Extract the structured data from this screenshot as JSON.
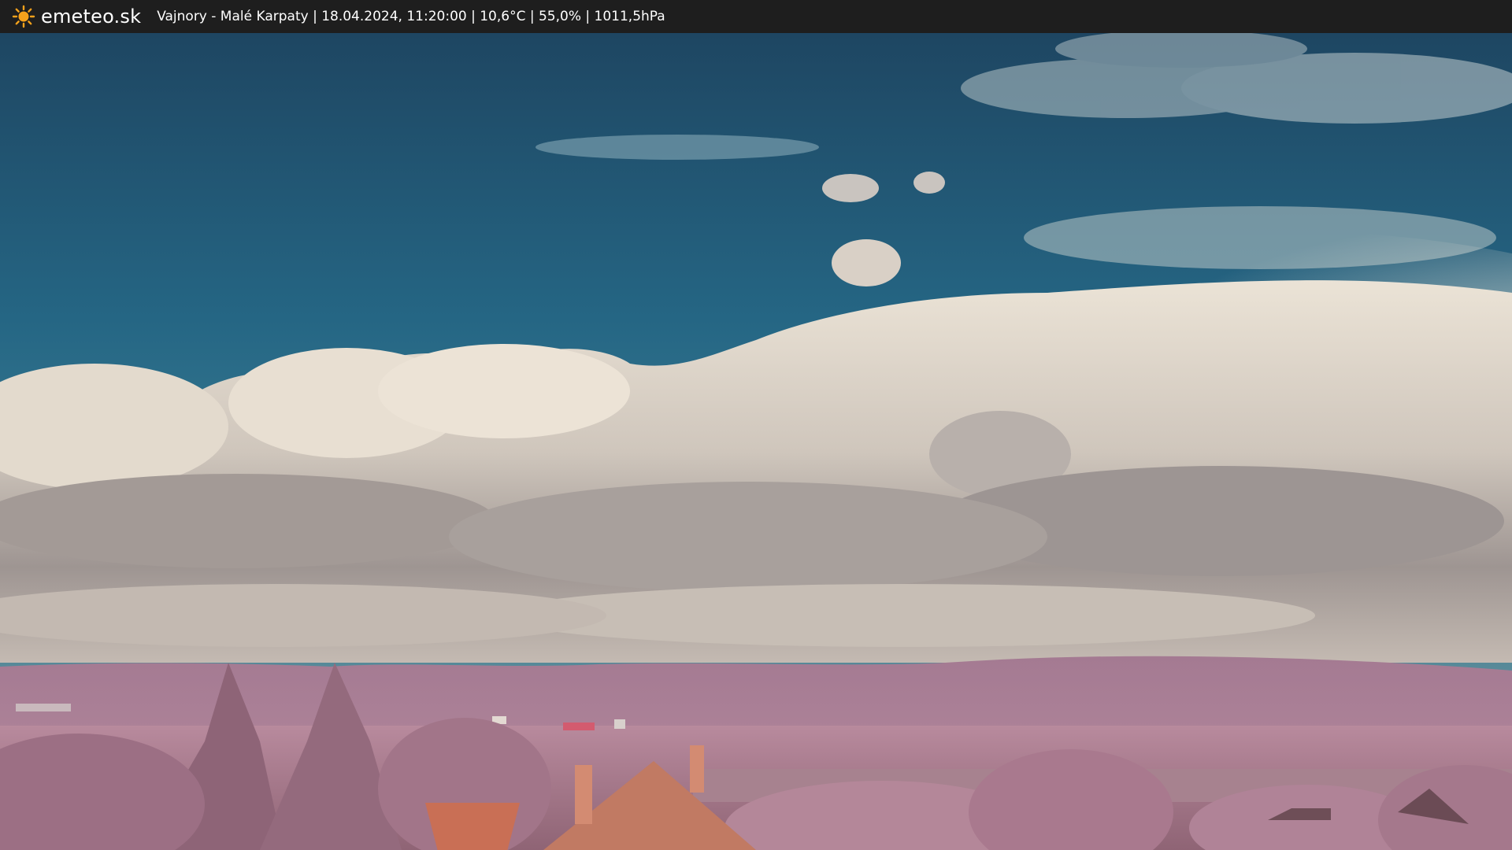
{
  "header": {
    "brand": "emeteo.sk",
    "logo_icon": "sun-icon",
    "caption": "Vajnory - Malé Karpaty | 18.04.2024, 11:20:00 | 10,6°C | 55,0% | 1011,5hPa"
  },
  "colors": {
    "bar": "#1e1e1e",
    "sun": "#f7a21b",
    "sky_top": "#1f4a68",
    "sky_mid": "#2a6f8c",
    "cloud_light": "#e6ddd0",
    "cloud_shadow": "#8f8886",
    "hills": "#a87f95",
    "foliage": "#b07f96",
    "roof": "#c96f55"
  }
}
